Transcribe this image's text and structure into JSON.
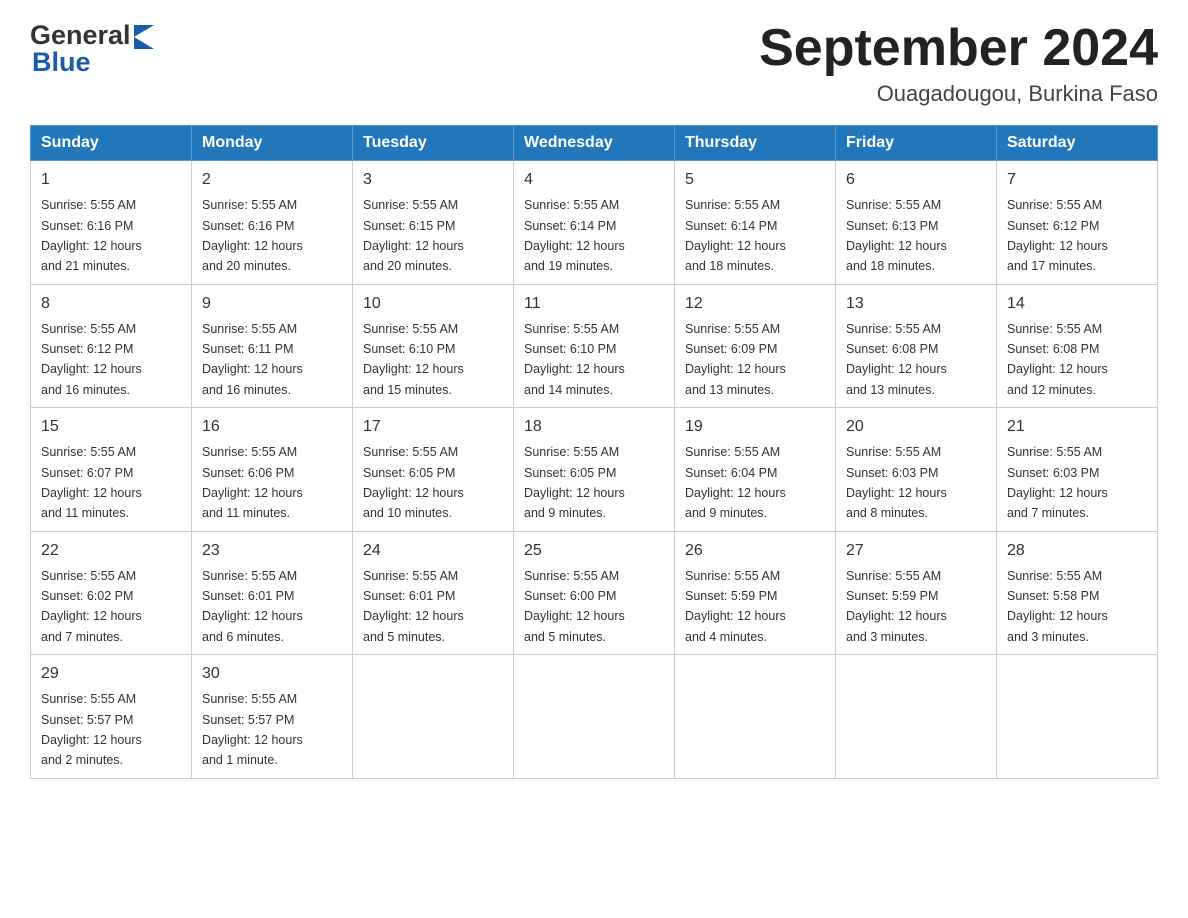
{
  "header": {
    "logo_general": "General",
    "logo_blue": "Blue",
    "title": "September 2024",
    "subtitle": "Ouagadougou, Burkina Faso"
  },
  "days_of_week": [
    "Sunday",
    "Monday",
    "Tuesday",
    "Wednesday",
    "Thursday",
    "Friday",
    "Saturday"
  ],
  "weeks": [
    [
      {
        "day": "1",
        "sunrise": "5:55 AM",
        "sunset": "6:16 PM",
        "daylight": "12 hours and 21 minutes."
      },
      {
        "day": "2",
        "sunrise": "5:55 AM",
        "sunset": "6:16 PM",
        "daylight": "12 hours and 20 minutes."
      },
      {
        "day": "3",
        "sunrise": "5:55 AM",
        "sunset": "6:15 PM",
        "daylight": "12 hours and 20 minutes."
      },
      {
        "day": "4",
        "sunrise": "5:55 AM",
        "sunset": "6:14 PM",
        "daylight": "12 hours and 19 minutes."
      },
      {
        "day": "5",
        "sunrise": "5:55 AM",
        "sunset": "6:14 PM",
        "daylight": "12 hours and 18 minutes."
      },
      {
        "day": "6",
        "sunrise": "5:55 AM",
        "sunset": "6:13 PM",
        "daylight": "12 hours and 18 minutes."
      },
      {
        "day": "7",
        "sunrise": "5:55 AM",
        "sunset": "6:12 PM",
        "daylight": "12 hours and 17 minutes."
      }
    ],
    [
      {
        "day": "8",
        "sunrise": "5:55 AM",
        "sunset": "6:12 PM",
        "daylight": "12 hours and 16 minutes."
      },
      {
        "day": "9",
        "sunrise": "5:55 AM",
        "sunset": "6:11 PM",
        "daylight": "12 hours and 16 minutes."
      },
      {
        "day": "10",
        "sunrise": "5:55 AM",
        "sunset": "6:10 PM",
        "daylight": "12 hours and 15 minutes."
      },
      {
        "day": "11",
        "sunrise": "5:55 AM",
        "sunset": "6:10 PM",
        "daylight": "12 hours and 14 minutes."
      },
      {
        "day": "12",
        "sunrise": "5:55 AM",
        "sunset": "6:09 PM",
        "daylight": "12 hours and 13 minutes."
      },
      {
        "day": "13",
        "sunrise": "5:55 AM",
        "sunset": "6:08 PM",
        "daylight": "12 hours and 13 minutes."
      },
      {
        "day": "14",
        "sunrise": "5:55 AM",
        "sunset": "6:08 PM",
        "daylight": "12 hours and 12 minutes."
      }
    ],
    [
      {
        "day": "15",
        "sunrise": "5:55 AM",
        "sunset": "6:07 PM",
        "daylight": "12 hours and 11 minutes."
      },
      {
        "day": "16",
        "sunrise": "5:55 AM",
        "sunset": "6:06 PM",
        "daylight": "12 hours and 11 minutes."
      },
      {
        "day": "17",
        "sunrise": "5:55 AM",
        "sunset": "6:05 PM",
        "daylight": "12 hours and 10 minutes."
      },
      {
        "day": "18",
        "sunrise": "5:55 AM",
        "sunset": "6:05 PM",
        "daylight": "12 hours and 9 minutes."
      },
      {
        "day": "19",
        "sunrise": "5:55 AM",
        "sunset": "6:04 PM",
        "daylight": "12 hours and 9 minutes."
      },
      {
        "day": "20",
        "sunrise": "5:55 AM",
        "sunset": "6:03 PM",
        "daylight": "12 hours and 8 minutes."
      },
      {
        "day": "21",
        "sunrise": "5:55 AM",
        "sunset": "6:03 PM",
        "daylight": "12 hours and 7 minutes."
      }
    ],
    [
      {
        "day": "22",
        "sunrise": "5:55 AM",
        "sunset": "6:02 PM",
        "daylight": "12 hours and 7 minutes."
      },
      {
        "day": "23",
        "sunrise": "5:55 AM",
        "sunset": "6:01 PM",
        "daylight": "12 hours and 6 minutes."
      },
      {
        "day": "24",
        "sunrise": "5:55 AM",
        "sunset": "6:01 PM",
        "daylight": "12 hours and 5 minutes."
      },
      {
        "day": "25",
        "sunrise": "5:55 AM",
        "sunset": "6:00 PM",
        "daylight": "12 hours and 5 minutes."
      },
      {
        "day": "26",
        "sunrise": "5:55 AM",
        "sunset": "5:59 PM",
        "daylight": "12 hours and 4 minutes."
      },
      {
        "day": "27",
        "sunrise": "5:55 AM",
        "sunset": "5:59 PM",
        "daylight": "12 hours and 3 minutes."
      },
      {
        "day": "28",
        "sunrise": "5:55 AM",
        "sunset": "5:58 PM",
        "daylight": "12 hours and 3 minutes."
      }
    ],
    [
      {
        "day": "29",
        "sunrise": "5:55 AM",
        "sunset": "5:57 PM",
        "daylight": "12 hours and 2 minutes."
      },
      {
        "day": "30",
        "sunrise": "5:55 AM",
        "sunset": "5:57 PM",
        "daylight": "12 hours and 1 minute."
      },
      null,
      null,
      null,
      null,
      null
    ]
  ],
  "labels": {
    "sunrise": "Sunrise:",
    "sunset": "Sunset:",
    "daylight": "Daylight:"
  }
}
